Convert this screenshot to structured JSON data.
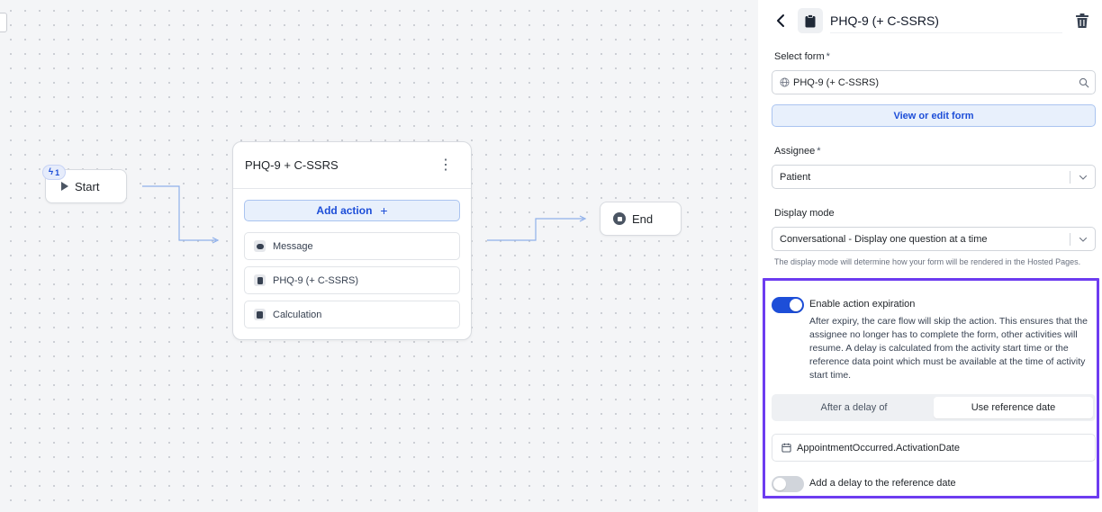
{
  "canvas": {
    "start_node": {
      "label": "Start",
      "trigger_count": "1"
    },
    "end_node": {
      "label": "End"
    },
    "step": {
      "title": "PHQ-9 + C-SSRS",
      "add_action_label": "Add action",
      "add_action_plus": "+",
      "actions": [
        {
          "label": "Message",
          "icon": "message-icon"
        },
        {
          "label": "PHQ-9 (+ C-SSRS)",
          "icon": "form-icon"
        },
        {
          "label": "Calculation",
          "icon": "calculator-icon"
        }
      ]
    }
  },
  "panel": {
    "title": "PHQ-9 (+ C-SSRS)",
    "select_form": {
      "label": "Select form",
      "required_mark": "*",
      "value": "PHQ-9 (+ C-SSRS)"
    },
    "view_edit_button": "View or edit form",
    "assignee": {
      "label": "Assignee",
      "required_mark": "*",
      "value": "Patient"
    },
    "display_mode": {
      "label": "Display mode",
      "value": "Conversational - Display one question at a time",
      "helper": "The display mode will determine how your form will be rendered in the Hosted Pages."
    },
    "expiration": {
      "toggle_label": "Enable action expiration",
      "enabled": true,
      "description": "After expiry, the care flow will skip the action. This ensures that the assignee no longer has to complete the form, other activities will resume. A delay is calculated from the activity start time or the reference data point which must be available at the time of activity start time.",
      "mode_options": [
        "After a delay of",
        "Use reference date"
      ],
      "selected_mode": "Use reference date",
      "reference_value": "AppointmentOccurred.ActivationDate",
      "delay_toggle_label": "Add a delay to the reference date",
      "delay_enabled": false
    }
  },
  "colors": {
    "accent": "#1d4ed8",
    "highlight": "#6d3cf0",
    "accent_bg": "#e8f0fc"
  }
}
